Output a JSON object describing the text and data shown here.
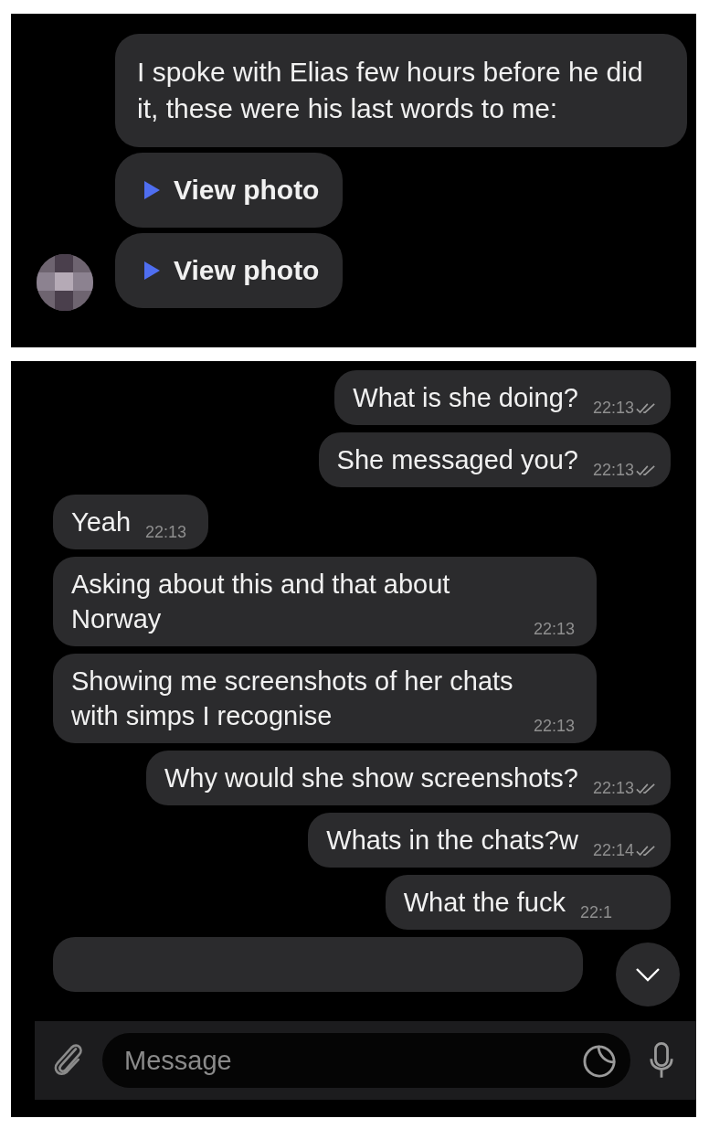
{
  "top_panel": {
    "messages": [
      {
        "kind": "text",
        "text": "I spoke with Elias few hours before he did it, these were his last words to me:"
      },
      {
        "kind": "photo",
        "label": "View photo"
      },
      {
        "kind": "photo",
        "label": "View photo"
      }
    ]
  },
  "chat": {
    "messages": [
      {
        "kind": "outgoing",
        "text": "What is she doing?",
        "time": "22:13",
        "checkmarks": true
      },
      {
        "kind": "outgoing",
        "text": "She messaged you?",
        "time": "22:13",
        "checkmarks": true
      },
      {
        "kind": "incoming",
        "text": "Yeah",
        "time": "22:13",
        "checkmarks": false
      },
      {
        "kind": "incoming",
        "text": "Asking about this and that about Norway",
        "time": "22:13",
        "checkmarks": false
      },
      {
        "kind": "incoming",
        "text": "Showing me screenshots of her chats with simps I recognise",
        "time": "22:13",
        "checkmarks": false
      },
      {
        "kind": "outgoing",
        "text": "Why would she show screenshots?",
        "time": "22:13",
        "checkmarks": true
      },
      {
        "kind": "outgoing",
        "text": "Whats in the chats?w",
        "time": "22:14",
        "checkmarks": true
      },
      {
        "kind": "outgoing",
        "text": "What the fuck",
        "time": "22:1",
        "checkmarks": false
      }
    ]
  },
  "composer": {
    "placeholder": "Message"
  }
}
